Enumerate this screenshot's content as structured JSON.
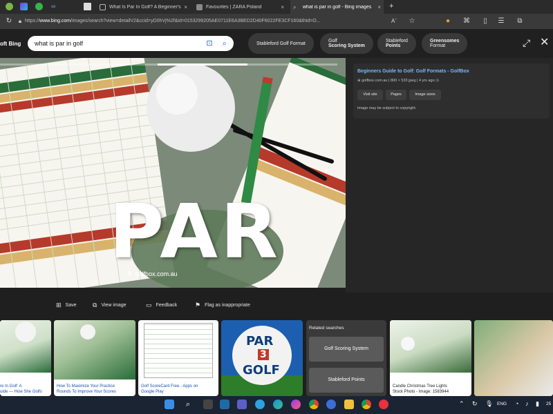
{
  "browser": {
    "tabs": [
      {
        "label": "What Is Par In Golf? A Beginner's",
        "close": "×"
      },
      {
        "label": "Favourites | ZARA Poland",
        "close": "×"
      },
      {
        "label": "what is par in golf - Bing images",
        "close": "×"
      }
    ],
    "new_tab": "+",
    "url_prefix": "https://",
    "url_host": "www.bing.com",
    "url_rest": "/images/search?view=detailV2&ccid=yD0hVj%2f&id=0153299205AE0711E6A3BED2D40F6022FE3CF160&thid=O..."
  },
  "bing": {
    "brand": "oft Bing",
    "search_value": "what is par in golf",
    "chips": [
      {
        "line1": "Stableford Golf Format",
        "line2": ""
      },
      {
        "line1": "Golf",
        "line2": "Scoring System"
      },
      {
        "line1": "Stableford",
        "line2": "Points"
      },
      {
        "line1": "Greensomes",
        "line2": "Format"
      }
    ]
  },
  "detail": {
    "image_watermark": "golfbox.com.au",
    "image_big_text": "PAR",
    "source_title": "Beginners Guide to Golf: Golf Formats - GolfBox",
    "source_domain": "golfbox.com.au",
    "source_size": "800 × 533 jpeg",
    "source_age": "4 yrs ago",
    "buttons": [
      "Visit site",
      "Pages",
      "Image sizes"
    ],
    "copyright": "Image may be subject to copyright."
  },
  "actions": [
    "Save",
    "View image",
    "Feedback",
    "Flag as inappropriate"
  ],
  "thumbnails": [
    {
      "cap1": "re In Golf: A",
      "cap2": "uide — How She Golfs"
    },
    {
      "cap1": "How To Maximize Your Practice",
      "cap2": "Rounds To Improve Your Scores"
    },
    {
      "cap1": "Golf ScoreCard Free - Apps on",
      "cap2": "Google Play"
    },
    {
      "cap1": "",
      "cap2": ""
    },
    {
      "cap1": "Candle Christmas Tree Lights",
      "cap2": "Stock Photo - Image: 1583944"
    }
  ],
  "par3_text": {
    "top": "PAR",
    "mid": "3",
    "bottom": "GOLF"
  },
  "related": {
    "title": "Related searches",
    "items": [
      "Golf Scoring System",
      "Stableford Points"
    ]
  },
  "taskbar": {
    "lang": "ENG",
    "clock": "25"
  },
  "colors": {
    "accent_link": "#7ab7ff",
    "bing_blue": "#1a63d8",
    "card_green": "#1f7a45"
  }
}
